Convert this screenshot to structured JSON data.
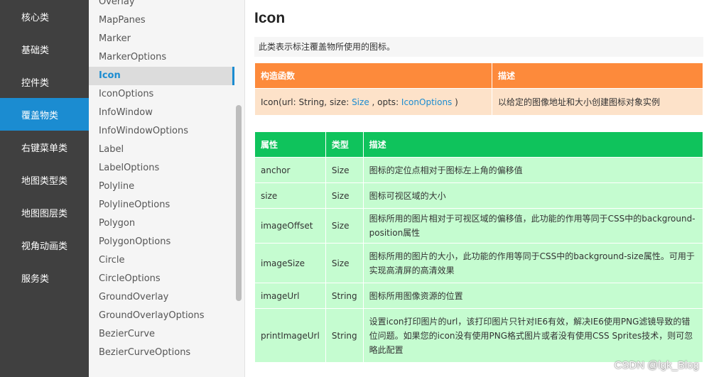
{
  "categories": [
    "核心类",
    "基础类",
    "控件类",
    "覆盖物类",
    "右键菜单类",
    "地图类型类",
    "地图图层类",
    "视角动画类",
    "服务类"
  ],
  "active_category_index": 3,
  "classes": [
    "Overlay",
    "MapPanes",
    "Marker",
    "MarkerOptions",
    "Icon",
    "IconOptions",
    "InfoWindow",
    "InfoWindowOptions",
    "Label",
    "LabelOptions",
    "Polyline",
    "PolylineOptions",
    "Polygon",
    "PolygonOptions",
    "Circle",
    "CircleOptions",
    "GroundOverlay",
    "GroundOverlayOptions",
    "BezierCurve",
    "BezierCurveOptions"
  ],
  "active_class_index": 4,
  "page": {
    "title": "Icon",
    "description": "此类表示标注覆盖物所使用的图标。"
  },
  "constructor_table": {
    "headers": [
      "构造函数",
      "描述"
    ],
    "signature_prefix": "Icon(url: String, size: ",
    "signature_size_link": "Size",
    "signature_mid": " , opts: ",
    "signature_opts_link": "IconOptions",
    "signature_suffix": " )",
    "description": "以给定的图像地址和大小创建图标对象实例"
  },
  "properties_table": {
    "headers": [
      "属性",
      "类型",
      "描述"
    ],
    "rows": [
      {
        "name": "anchor",
        "type": "Size",
        "type_is_link": true,
        "description": "图标的定位点相对于图标左上角的偏移值"
      },
      {
        "name": "size",
        "type": "Size",
        "type_is_link": true,
        "description": "图标可视区域的大小"
      },
      {
        "name": "imageOffset",
        "type": "Size",
        "type_is_link": true,
        "description": "图标所用的图片相对于可视区域的偏移值，此功能的作用等同于CSS中的background-position属性"
      },
      {
        "name": "imageSize",
        "type": "Size",
        "type_is_link": true,
        "description": "图标所用的图片的大小，此功能的作用等同于CSS中的background-size属性。可用于实现高清屏的高清效果"
      },
      {
        "name": "imageUrl",
        "type": "String",
        "type_is_link": false,
        "description": "图标所用图像资源的位置"
      },
      {
        "name": "printImageUrl",
        "type": "String",
        "type_is_link": false,
        "description": "设置icon打印图片的url，该打印图片只针对IE6有效，解决IE6使用PNG滤镜导致的错位问题。如果您的icon没有使用PNG格式图片或者没有使用CSS Sprites技术，则可忽略此配置"
      }
    ]
  },
  "watermark": "CSDN @lgk_Blog",
  "colors": {
    "nav_bg": "#404040",
    "nav_active": "#1b8cd1",
    "ctor_header": "#fd8a3b",
    "ctor_row": "#fde2c9",
    "prop_header": "#0fc35c",
    "prop_row": "#c5fcd0",
    "link": "#1b8cd1"
  }
}
